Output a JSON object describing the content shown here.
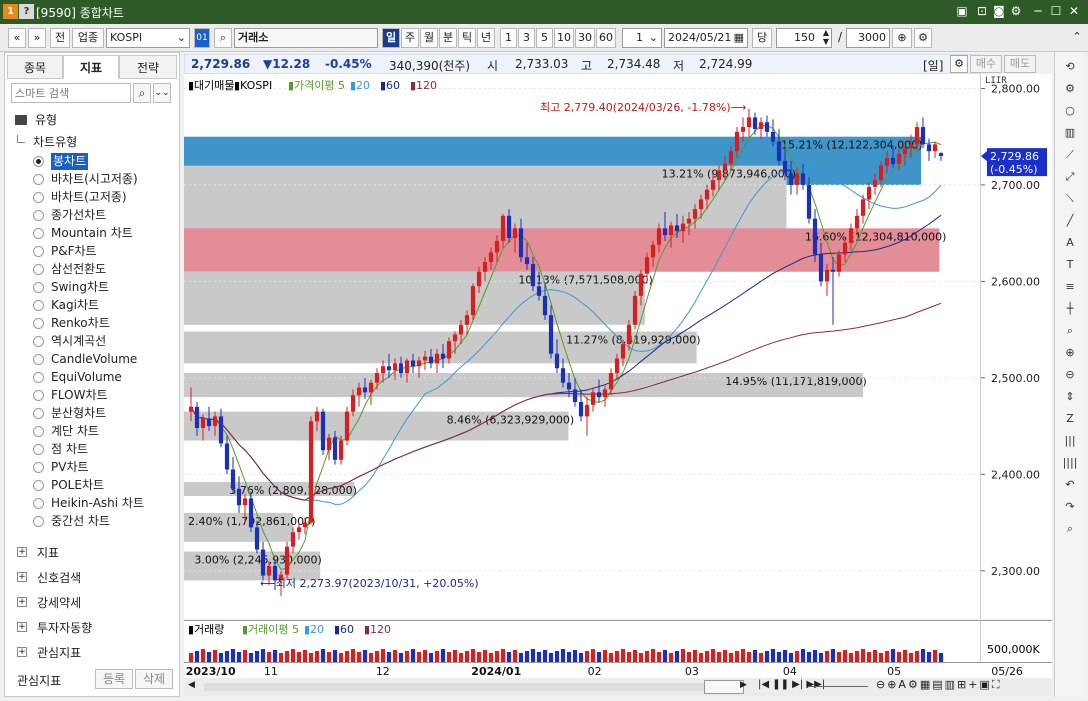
{
  "window": {
    "title": "[9590] 종합차트",
    "icons": [
      "1",
      "?"
    ],
    "controls": [
      "restore-icon",
      "pin-icon",
      "camera-icon",
      "gear-icon",
      "minimize-icon",
      "maximize-icon",
      "close-icon"
    ]
  },
  "toolbar": {
    "nav_prev": "«",
    "nav_down": "»",
    "jeon": "전",
    "industry": "업종",
    "code": "KOSPI",
    "code_badge": "01",
    "market": "거래소",
    "periods": [
      "일",
      "주",
      "월",
      "분",
      "틱",
      "년"
    ],
    "active_period": "일",
    "intervals": [
      "1",
      "3",
      "5",
      "10",
      "30",
      "60"
    ],
    "count_box": "1",
    "date": "2024/05/21",
    "dang": "당",
    "view_count": "150",
    "slash": "/",
    "total_count": "3000"
  },
  "left_panel": {
    "tabs": [
      "종목",
      "지표",
      "전략"
    ],
    "active_tab": "지표",
    "search_placeholder": "스마트 검색",
    "group_title": "유형",
    "subgroup_title": "차트유형",
    "chart_types": [
      "봉차트",
      "바차트(시고저종)",
      "바차트(고저종)",
      "종가선차트",
      "Mountain 차트",
      "P&F차트",
      "삼선전환도",
      "Swing차트",
      "Kagi차트",
      "Renko차트",
      "역시계곡선",
      "CandleVolume",
      "EquiVolume",
      "FLOW차트",
      "분산형차트",
      "계단 차트",
      "점 차트",
      "PV차트",
      "POLE차트",
      "Heikin-Ashi 차트",
      "중간선 차트"
    ],
    "selected_type": "봉차트",
    "sections": [
      "지표",
      "신호검색",
      "강세약세",
      "투자자동향",
      "관심지표"
    ],
    "footer_label": "관심지표",
    "footer_buttons": [
      "등록",
      "삭제"
    ]
  },
  "info_bar": {
    "price": "2,729.86",
    "change": "▼12.28",
    "change_pct": "-0.45%",
    "volume": "340,390(천주)",
    "open_label": "시",
    "open": "2,733.03",
    "high_label": "고",
    "high": "2,734.48",
    "low_label": "저",
    "low": "2,724.99",
    "period_label": "[일]",
    "buy": "매수",
    "sell": "매도"
  },
  "chart_legend": {
    "items": [
      "대기매물",
      "KOSPI",
      "가격이평 5",
      "20",
      "60",
      "120"
    ],
    "colors": [
      "#000000",
      "#000000",
      "#5a9a2a",
      "#3a9ad9",
      "#1a2a8a",
      "#8a2a4a"
    ]
  },
  "annotations": {
    "high": "최고 2,779.40(2024/03/26, -1.78%)⟶",
    "low": "⟵최저 2,273.97(2023/10/31, +20.05%)"
  },
  "chart_data": {
    "type": "candlestick",
    "y_axis": {
      "ticks": [
        "2,800.00",
        "2,700.00",
        "2,600.00",
        "2,500.00",
        "2,400.00",
        "2,300.00"
      ],
      "ylim": [
        2250,
        2815
      ]
    },
    "x_axis": {
      "ticks": [
        "2023/10",
        "11",
        "12",
        "2024/01",
        "02",
        "03",
        "04",
        "05",
        "05/26"
      ]
    },
    "last_price_label": "2,729.86",
    "last_change_label": "(-0.45%)",
    "volume_profile": [
      {
        "label": "15.21% (12,122,304,000)",
        "highlight": "blue"
      },
      {
        "label": "13.21% (9,873,946,000)",
        "highlight": "none"
      },
      {
        "label": "16.60% (12,304,810,000)",
        "highlight": "red"
      },
      {
        "label": "10.13% (7,571,508,000)",
        "highlight": "none"
      },
      {
        "label": "11.27% (8,419,929,000)",
        "highlight": "none"
      },
      {
        "label": "14.95% (11,171,819,000)",
        "highlight": "none"
      },
      {
        "label": "8.46% (6,323,929,000)",
        "highlight": "none"
      },
      {
        "label": "3.76% (2,809,128,000)",
        "highlight": "none"
      },
      {
        "label": "2.40% (1,792,861,000)",
        "highlight": "none"
      },
      {
        "label": "3.00% (2,245,930,000)",
        "highlight": "none"
      }
    ],
    "candles": [
      [
        2465,
        2490,
        2455,
        2470
      ],
      [
        2470,
        2475,
        2440,
        2448
      ],
      [
        2448,
        2462,
        2435,
        2458
      ],
      [
        2458,
        2470,
        2445,
        2450
      ],
      [
        2450,
        2465,
        2440,
        2460
      ],
      [
        2460,
        2468,
        2428,
        2432
      ],
      [
        2432,
        2440,
        2400,
        2405
      ],
      [
        2405,
        2418,
        2380,
        2385
      ],
      [
        2385,
        2398,
        2360,
        2368
      ],
      [
        2368,
        2380,
        2350,
        2375
      ],
      [
        2375,
        2382,
        2340,
        2345
      ],
      [
        2345,
        2352,
        2318,
        2322
      ],
      [
        2322,
        2330,
        2290,
        2295
      ],
      [
        2295,
        2310,
        2285,
        2305
      ],
      [
        2305,
        2312,
        2280,
        2290
      ],
      [
        2290,
        2300,
        2274,
        2296
      ],
      [
        2296,
        2330,
        2292,
        2325
      ],
      [
        2325,
        2345,
        2318,
        2340
      ],
      [
        2340,
        2350,
        2332,
        2345
      ],
      [
        2345,
        2355,
        2338,
        2350
      ],
      [
        2350,
        2460,
        2348,
        2455
      ],
      [
        2455,
        2470,
        2445,
        2465
      ],
      [
        2465,
        2468,
        2420,
        2425
      ],
      [
        2425,
        2442,
        2415,
        2438
      ],
      [
        2438,
        2445,
        2410,
        2415
      ],
      [
        2415,
        2440,
        2410,
        2435
      ],
      [
        2435,
        2470,
        2430,
        2465
      ],
      [
        2465,
        2488,
        2460,
        2482
      ],
      [
        2482,
        2495,
        2470,
        2490
      ],
      [
        2490,
        2500,
        2478,
        2485
      ],
      [
        2485,
        2498,
        2472,
        2495
      ],
      [
        2495,
        2510,
        2488,
        2505
      ],
      [
        2505,
        2518,
        2495,
        2512
      ],
      [
        2512,
        2525,
        2500,
        2508
      ],
      [
        2508,
        2520,
        2498,
        2515
      ],
      [
        2515,
        2522,
        2500,
        2505
      ],
      [
        2505,
        2520,
        2495,
        2518
      ],
      [
        2518,
        2525,
        2505,
        2512
      ],
      [
        2512,
        2522,
        2500,
        2518
      ],
      [
        2518,
        2528,
        2508,
        2522
      ],
      [
        2522,
        2530,
        2510,
        2515
      ],
      [
        2515,
        2530,
        2505,
        2525
      ],
      [
        2525,
        2535,
        2510,
        2520
      ],
      [
        2520,
        2542,
        2515,
        2538
      ],
      [
        2538,
        2548,
        2525,
        2545
      ],
      [
        2545,
        2560,
        2535,
        2555
      ],
      [
        2555,
        2570,
        2545,
        2565
      ],
      [
        2565,
        2598,
        2560,
        2595
      ],
      [
        2595,
        2615,
        2588,
        2610
      ],
      [
        2610,
        2625,
        2600,
        2620
      ],
      [
        2620,
        2635,
        2612,
        2630
      ],
      [
        2630,
        2648,
        2620,
        2642
      ],
      [
        2642,
        2670,
        2635,
        2668
      ],
      [
        2668,
        2675,
        2640,
        2645
      ],
      [
        2645,
        2660,
        2630,
        2655
      ],
      [
        2655,
        2665,
        2620,
        2625
      ],
      [
        2625,
        2640,
        2612,
        2618
      ],
      [
        2618,
        2625,
        2590,
        2595
      ],
      [
        2595,
        2610,
        2580,
        2585
      ],
      [
        2585,
        2598,
        2560,
        2565
      ],
      [
        2565,
        2575,
        2520,
        2525
      ],
      [
        2525,
        2540,
        2505,
        2510
      ],
      [
        2510,
        2520,
        2490,
        2495
      ],
      [
        2495,
        2505,
        2480,
        2488
      ],
      [
        2488,
        2500,
        2470,
        2475
      ],
      [
        2475,
        2488,
        2455,
        2460
      ],
      [
        2460,
        2480,
        2440,
        2472
      ],
      [
        2472,
        2490,
        2465,
        2485
      ],
      [
        2485,
        2498,
        2475,
        2480
      ],
      [
        2480,
        2492,
        2470,
        2488
      ],
      [
        2488,
        2510,
        2482,
        2505
      ],
      [
        2505,
        2525,
        2498,
        2520
      ],
      [
        2520,
        2540,
        2512,
        2535
      ],
      [
        2535,
        2560,
        2528,
        2555
      ],
      [
        2555,
        2590,
        2550,
        2585
      ],
      [
        2585,
        2612,
        2575,
        2608
      ],
      [
        2608,
        2630,
        2598,
        2625
      ],
      [
        2625,
        2642,
        2615,
        2638
      ],
      [
        2638,
        2660,
        2630,
        2655
      ],
      [
        2655,
        2672,
        2642,
        2648
      ],
      [
        2648,
        2662,
        2635,
        2658
      ],
      [
        2658,
        2670,
        2645,
        2652
      ],
      [
        2652,
        2668,
        2640,
        2660
      ],
      [
        2660,
        2672,
        2648,
        2665
      ],
      [
        2665,
        2680,
        2655,
        2675
      ],
      [
        2675,
        2690,
        2665,
        2685
      ],
      [
        2685,
        2700,
        2675,
        2695
      ],
      [
        2695,
        2712,
        2688,
        2705
      ],
      [
        2705,
        2720,
        2695,
        2715
      ],
      [
        2715,
        2730,
        2705,
        2722
      ],
      [
        2722,
        2740,
        2715,
        2735
      ],
      [
        2735,
        2760,
        2728,
        2755
      ],
      [
        2755,
        2770,
        2745,
        2760
      ],
      [
        2760,
        2779,
        2750,
        2770
      ],
      [
        2770,
        2775,
        2752,
        2758
      ],
      [
        2758,
        2770,
        2748,
        2765
      ],
      [
        2765,
        2772,
        2750,
        2755
      ],
      [
        2755,
        2768,
        2740,
        2745
      ],
      [
        2745,
        2758,
        2720,
        2725
      ],
      [
        2725,
        2738,
        2705,
        2712
      ],
      [
        2712,
        2725,
        2690,
        2700
      ],
      [
        2700,
        2718,
        2690,
        2712
      ],
      [
        2712,
        2722,
        2695,
        2700
      ],
      [
        2700,
        2708,
        2660,
        2665
      ],
      [
        2665,
        2675,
        2620,
        2628
      ],
      [
        2628,
        2640,
        2595,
        2600
      ],
      [
        2600,
        2618,
        2585,
        2612
      ],
      [
        2612,
        2625,
        2555,
        2610
      ],
      [
        2610,
        2632,
        2605,
        2628
      ],
      [
        2628,
        2645,
        2620,
        2640
      ],
      [
        2640,
        2660,
        2632,
        2655
      ],
      [
        2655,
        2675,
        2648,
        2668
      ],
      [
        2668,
        2690,
        2660,
        2685
      ],
      [
        2685,
        2702,
        2675,
        2698
      ],
      [
        2698,
        2712,
        2690,
        2705
      ],
      [
        2705,
        2725,
        2698,
        2720
      ],
      [
        2720,
        2735,
        2712,
        2728
      ],
      [
        2728,
        2740,
        2718,
        2722
      ],
      [
        2722,
        2738,
        2715,
        2732
      ],
      [
        2732,
        2745,
        2720,
        2738
      ],
      [
        2738,
        2752,
        2728,
        2742
      ],
      [
        2742,
        2765,
        2735,
        2760
      ],
      [
        2760,
        2770,
        2738,
        2742
      ],
      [
        2742,
        2748,
        2725,
        2735
      ],
      [
        2735,
        2745,
        2728,
        2742
      ],
      [
        2733,
        2734,
        2725,
        2730
      ]
    ],
    "volume_label": "거래량",
    "volume_legend": [
      "거래이평 5",
      "20",
      "60",
      "120"
    ],
    "volume_axis_label": "500,000K"
  },
  "bottom_bar": {
    "tools": [
      "◀",
      "▶",
      "|◀",
      "❚❚",
      "▶|",
      "▶▶|",
      "⊖",
      "⊕",
      "A",
      "gear-icon",
      "grid-icon",
      "table-icon",
      "list-icon",
      "cross-icon",
      "expand-icon"
    ]
  },
  "right_tools": [
    "refresh-icon",
    "gear-icon",
    "circle-icon",
    "chart-icon",
    "line-tool-icon",
    "ray-tool-icon",
    "trend-tool-icon",
    "diag-icon",
    "auto-icon",
    "text-icon",
    "all-icon",
    "candle-icon",
    "zoom-icon",
    "magnify-icon",
    "magnify-minus-icon",
    "arrows-icon",
    "z-icon",
    "bars-icon",
    "bars2-icon",
    "undo-icon",
    "redo-icon",
    "search-icon"
  ]
}
